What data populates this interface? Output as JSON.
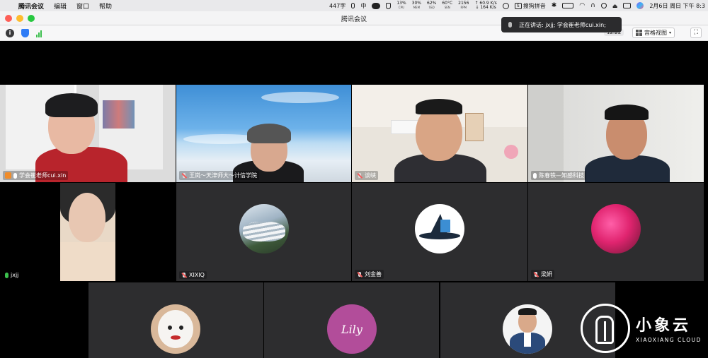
{
  "menubar": {
    "app_name": "腾讯会议",
    "items": [
      "编辑",
      "窗口",
      "帮助"
    ],
    "word_count": "447字",
    "input_lang": "中",
    "cpu": "13%",
    "cpu_label": "CPU",
    "mem": "30%",
    "mem_label": "MEM",
    "ssd": "62%",
    "ssd_label": "SSD",
    "sen": "60°C",
    "sen_label": "SEN",
    "rpm": "2156",
    "rpm_label": "RPM",
    "net_up": "↑ 60.9 K/s",
    "net_down": "↓ 164 K/s",
    "ime": "搜狗拼音",
    "datetime": "2月6日 周日 下午 8:3"
  },
  "window": {
    "title": "腾讯会议"
  },
  "toolbar": {
    "time": "12:22",
    "view_label": "宫格视图"
  },
  "speaking": {
    "text": "正在讲话: jxjj; 学会崔老师cui.xin;"
  },
  "participants": [
    {
      "name": "学会崔老师cui.xin"
    },
    {
      "name": "王岚～天津师大～计信学院"
    },
    {
      "name": "谈峡"
    },
    {
      "name": "陈春铁—知感科技"
    },
    {
      "name": "jxjj"
    },
    {
      "name": "XIXIQ"
    },
    {
      "name": "刘金善"
    },
    {
      "name": "梁妍"
    }
  ],
  "avatars": {
    "lily_text": "Lily"
  },
  "logo": {
    "cn": "小象云",
    "en": "XIAOXIANG CLOUD"
  },
  "colors": {
    "tile_bg": "#2d2d2f",
    "host_badge": "#f08c2a",
    "active_mic": "#3bbf4d"
  }
}
